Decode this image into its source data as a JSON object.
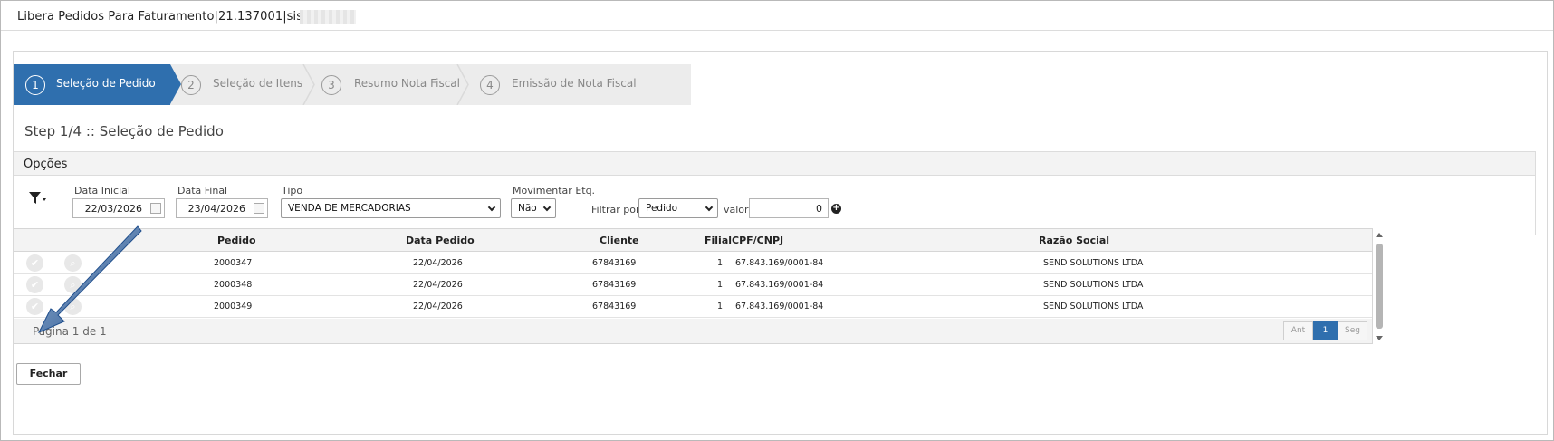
{
  "window": {
    "title": "Libera Pedidos Para Faturamento|21.137001|sis_"
  },
  "wizard": {
    "steps": [
      {
        "num": "1",
        "label": "Seleção de Pedido"
      },
      {
        "num": "2",
        "label": "Seleção de Itens"
      },
      {
        "num": "3",
        "label": "Resumo Nota Fiscal"
      },
      {
        "num": "4",
        "label": "Emissão de Nota Fiscal"
      }
    ],
    "active_step": 1
  },
  "page": {
    "step_title": "Step 1/4 :: Seleção de Pedido"
  },
  "options": {
    "header": "Opções",
    "data_inicial_label": "Data Inicial",
    "data_inicial_value": "22/03/2026",
    "data_final_label": "Data Final",
    "data_final_value": "23/04/2026",
    "tipo_label": "Tipo",
    "tipo_value": "VENDA DE MERCADORIAS",
    "movimentar_label": "Movimentar Etq.",
    "movimentar_value": "Não",
    "filtrar_label": "Filtrar por",
    "filtrar_value": "Pedido",
    "valor_label": "valor",
    "valor_value": "0"
  },
  "grid": {
    "columns": [
      "Pedido",
      "Data Pedido",
      "Cliente",
      "Filial",
      "CPF/CNPJ",
      "Razão Social"
    ],
    "rows": [
      {
        "pedido": "2000347",
        "data": "22/04/2026",
        "cliente": "67843169",
        "filial": "1",
        "cnpj": "67.843.169/0001-84",
        "razao": "SEND SOLUTIONS LTDA"
      },
      {
        "pedido": "2000348",
        "data": "22/04/2026",
        "cliente": "67843169",
        "filial": "1",
        "cnpj": "67.843.169/0001-84",
        "razao": "SEND SOLUTIONS LTDA"
      },
      {
        "pedido": "2000349",
        "data": "22/04/2026",
        "cliente": "67843169",
        "filial": "1",
        "cnpj": "67.843.169/0001-84",
        "razao": "SEND SOLUTIONS LTDA"
      }
    ],
    "page_info": "Página 1 de 1",
    "pager": {
      "prev": "Ant",
      "current": "1",
      "next": "Seg"
    }
  },
  "actions": {
    "close_label": "Fechar"
  },
  "colors": {
    "accent": "#2f6fae",
    "annotation_arrow": "#1f4e8c"
  },
  "icons": {
    "row_select": "check-icon",
    "row_view": "search-icon",
    "filter": "filter-icon",
    "calendar": "calendar-icon",
    "add": "plus-icon"
  }
}
